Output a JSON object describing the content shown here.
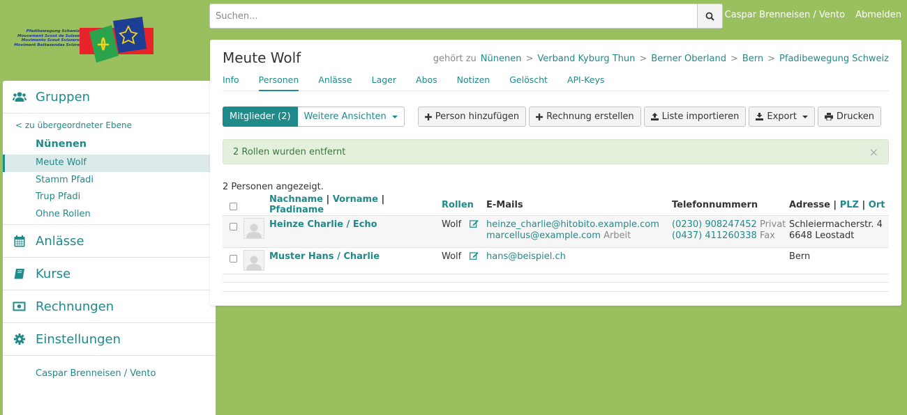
{
  "logo": {
    "lines": [
      "Pfadibewegung Schweiz",
      "Mouvement Scout de Suisse",
      "Movimento Scout Svizzero",
      "Moviment Battasendas Svizra"
    ]
  },
  "search": {
    "placeholder": "Suchen...",
    "value": ""
  },
  "topnav": {
    "user": "Caspar Brenneisen / Vento",
    "logout": "Abmelden"
  },
  "sidebar": {
    "sections": [
      {
        "label": "Gruppen",
        "icon": "users-icon"
      },
      {
        "label": "Anlässe",
        "icon": "calendar-icon"
      },
      {
        "label": "Kurse",
        "icon": "book-icon"
      },
      {
        "label": "Rechnungen",
        "icon": "money-icon"
      },
      {
        "label": "Einstellungen",
        "icon": "gear-icon"
      }
    ],
    "back_link": "< zu übergeordneter Ebene",
    "group": "Nünenen",
    "items": [
      {
        "label": "Meute Wolf",
        "active": true
      },
      {
        "label": "Stamm Pfadi"
      },
      {
        "label": "Trup Pfadi"
      },
      {
        "label": "Ohne Rollen"
      }
    ],
    "user_link": "Caspar Brenneisen / Vento"
  },
  "page": {
    "title": "Meute Wolf",
    "belongs_to": "gehört zu",
    "breadcrumbs": [
      "Nünenen",
      "Verband Kyburg Thun",
      "Berner Oberland",
      "Bern",
      "Pfadibewegung Schweiz"
    ],
    "tabs": [
      {
        "label": "Info"
      },
      {
        "label": "Personen",
        "active": true
      },
      {
        "label": "Anlässe"
      },
      {
        "label": "Lager"
      },
      {
        "label": "Abos"
      },
      {
        "label": "Notizen"
      },
      {
        "label": "Gelöscht"
      },
      {
        "label": "API-Keys"
      }
    ]
  },
  "toolbar": {
    "members": "Mitglieder (2)",
    "more_views": "Weitere Ansichten",
    "add_person": "Person hinzufügen",
    "create_invoice": "Rechnung erstellen",
    "import_list": "Liste importieren",
    "export": "Export",
    "print": "Drucken"
  },
  "alert": {
    "message": "2 Rollen wurden entfernt",
    "close": "×"
  },
  "list": {
    "count": "2 Personen angezeigt.",
    "headers": {
      "lastname": "Nachname",
      "firstname": "Vorname",
      "nickname": "Pfadiname",
      "roles": "Rollen",
      "emails": "E-Mails",
      "phones": "Telefonnummern",
      "address": "Adresse",
      "zip": "PLZ",
      "city": "Ort"
    },
    "rows": [
      {
        "name": "Heinze Charlie / Echo",
        "role": "Wolf",
        "emails": [
          {
            "address": "heinze_charlie@hitobito.example.com",
            "label": ""
          },
          {
            "address": "marcellus@example.com",
            "label": "Arbeit"
          }
        ],
        "phones": [
          {
            "number": "(0230) 908247452",
            "label": "Privat"
          },
          {
            "number": "(0437) 411260338",
            "label": "Fax"
          }
        ],
        "address": [
          "Schleiermacherstr. 4",
          "6648 Leostadt"
        ]
      },
      {
        "name": "Muster Hans / Charlie",
        "role": "Wolf",
        "emails": [
          {
            "address": "hans@beispiel.ch",
            "label": ""
          }
        ],
        "phones": [],
        "address": [
          "Bern"
        ]
      }
    ]
  }
}
